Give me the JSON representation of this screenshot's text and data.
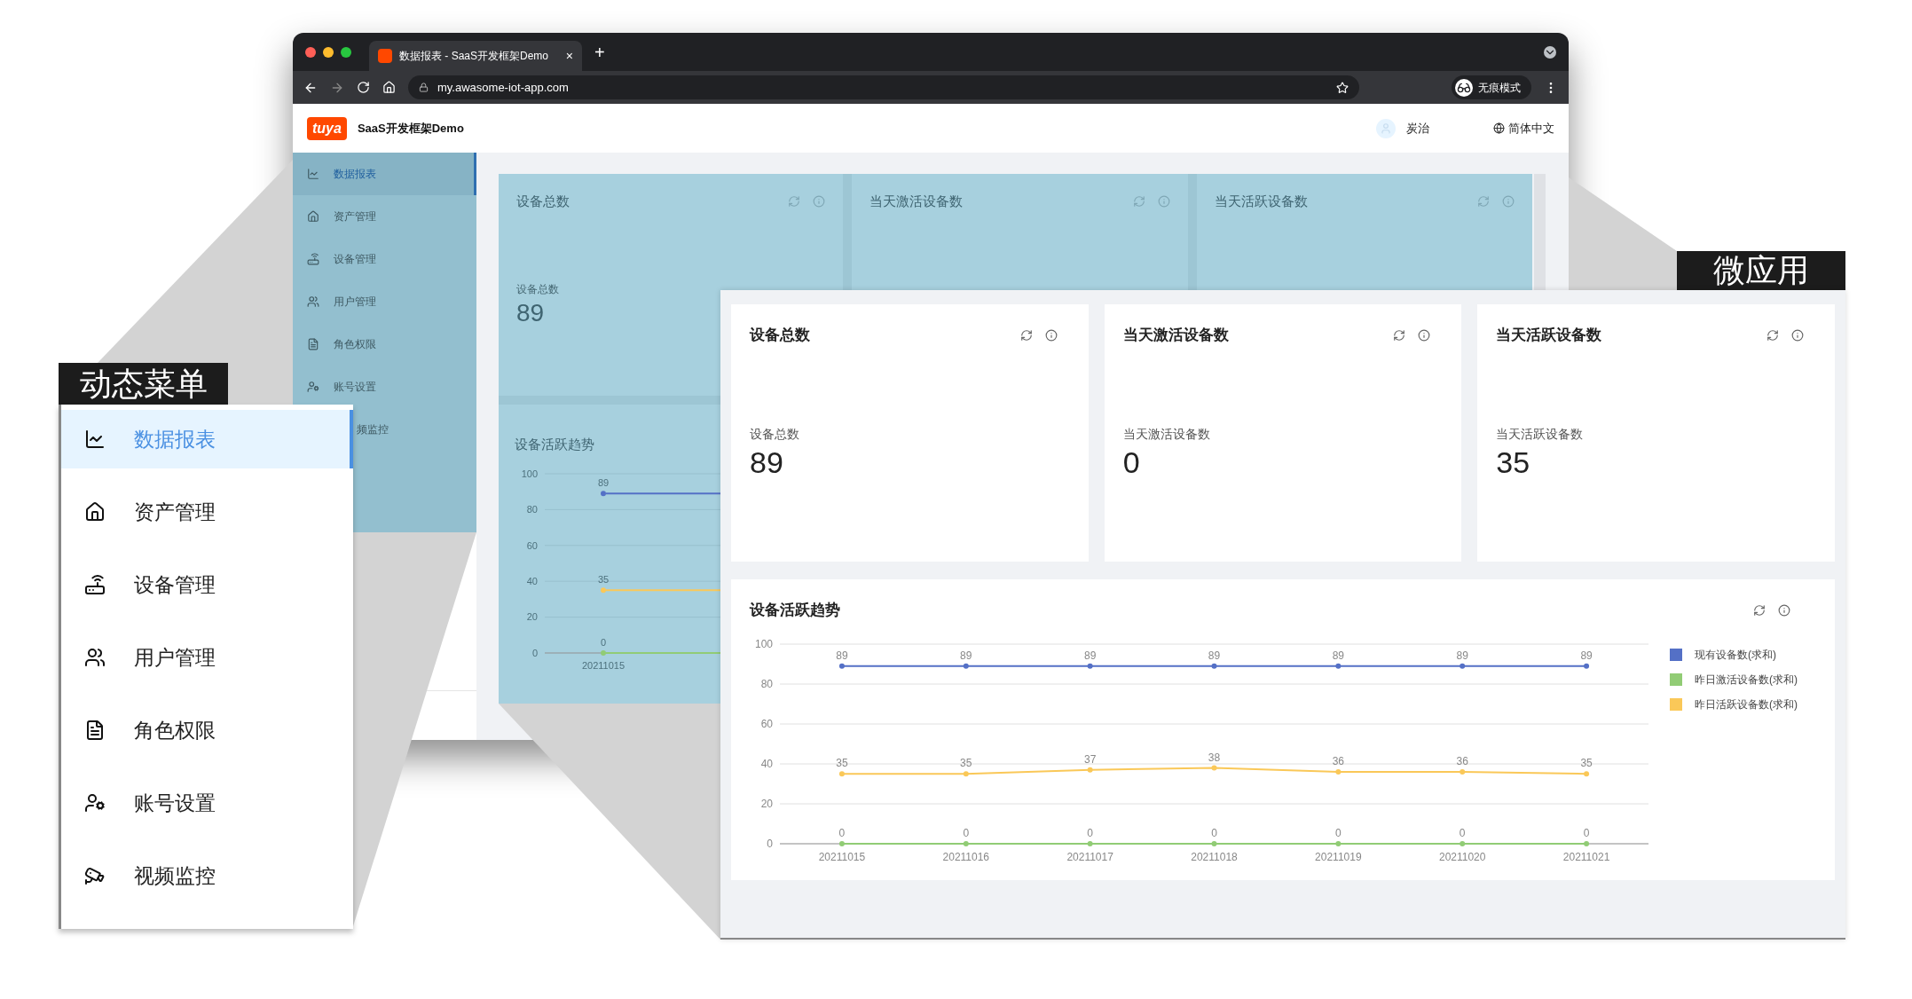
{
  "browser": {
    "tab_title": "数据报表 - SaaS开发框架Demo",
    "tab_close": "×",
    "new_tab": "+",
    "url": "my.awasome-iot-app.com",
    "incognito": "无痕模式"
  },
  "header": {
    "logo": "tuya",
    "app_name": "SaaS开发框架Demo",
    "user": "炭治",
    "language": "简体中文"
  },
  "sidebar": {
    "items": [
      {
        "label": "数据报表",
        "selected": true,
        "clipped": false
      },
      {
        "label": "资产管理",
        "selected": false,
        "clipped": false
      },
      {
        "label": "设备管理",
        "selected": false,
        "clipped": false
      },
      {
        "label": "用户管理",
        "selected": false,
        "clipped": false
      },
      {
        "label": "角色权限",
        "selected": false,
        "clipped": false
      },
      {
        "label": "账号设置",
        "selected": false,
        "clipped": false
      },
      {
        "label": "频监控",
        "selected": false,
        "clipped": true
      }
    ]
  },
  "stat_cards": [
    {
      "title": "设备总数",
      "label": "设备总数",
      "value": "89"
    },
    {
      "title": "当天激活设备数"
    },
    {
      "title": "当天活跃设备数"
    }
  ],
  "trend_card": {
    "title": "设备活跃趋势",
    "chart_data": {
      "type": "line",
      "categories": [
        "20211015"
      ],
      "yticks": [
        0,
        20,
        40,
        60,
        80,
        100
      ],
      "ylim": [
        0,
        100
      ],
      "grid": true,
      "data_labels": true,
      "series": [
        {
          "color": "#5470c6",
          "values": [
            89
          ],
          "marker": true
        },
        {
          "color": "#91cc75",
          "values": [
            0
          ],
          "marker": true
        },
        {
          "color": "#fac858",
          "values": [
            35
          ],
          "marker": true
        }
      ]
    }
  },
  "left_callout": {
    "label": "动态菜单",
    "menu": [
      {
        "label": "数据报表",
        "selected": true
      },
      {
        "label": "资产管理",
        "selected": false
      },
      {
        "label": "设备管理",
        "selected": false
      },
      {
        "label": "用户管理",
        "selected": false
      },
      {
        "label": "角色权限",
        "selected": false
      },
      {
        "label": "账号设置",
        "selected": false
      },
      {
        "label": "视频监控",
        "selected": false
      }
    ]
  },
  "right_callout": {
    "label": "微应用",
    "stat_cards": [
      {
        "title": "设备总数",
        "label": "设备总数",
        "value": "89"
      },
      {
        "title": "当天激活设备数",
        "label": "当天激活设备数",
        "value": "0"
      },
      {
        "title": "当天活跃设备数",
        "label": "当天活跃设备数",
        "value": "35"
      }
    ],
    "trend_card": {
      "title": "设备活跃趋势",
      "chart_data": {
        "type": "line",
        "categories": [
          "20211015",
          "20211016",
          "20211017",
          "20211018",
          "20211019",
          "20211020",
          "20211021"
        ],
        "yticks": [
          0,
          20,
          40,
          60,
          80,
          100
        ],
        "ylim": [
          0,
          100
        ],
        "grid": true,
        "data_labels": true,
        "series": [
          {
            "name": "现有设备数(求和)",
            "color": "#5470c6",
            "values": [
              89,
              89,
              89,
              89,
              89,
              89,
              89
            ],
            "marker": true
          },
          {
            "name": "昨日激活设备数(求和)",
            "color": "#91cc75",
            "values": [
              0,
              0,
              0,
              0,
              0,
              0,
              0
            ],
            "marker": true
          },
          {
            "name": "昨日活跃设备数(求和)",
            "color": "#fac858",
            "values": [
              35,
              35,
              37,
              38,
              36,
              36,
              35
            ],
            "marker": true
          }
        ]
      }
    }
  }
}
